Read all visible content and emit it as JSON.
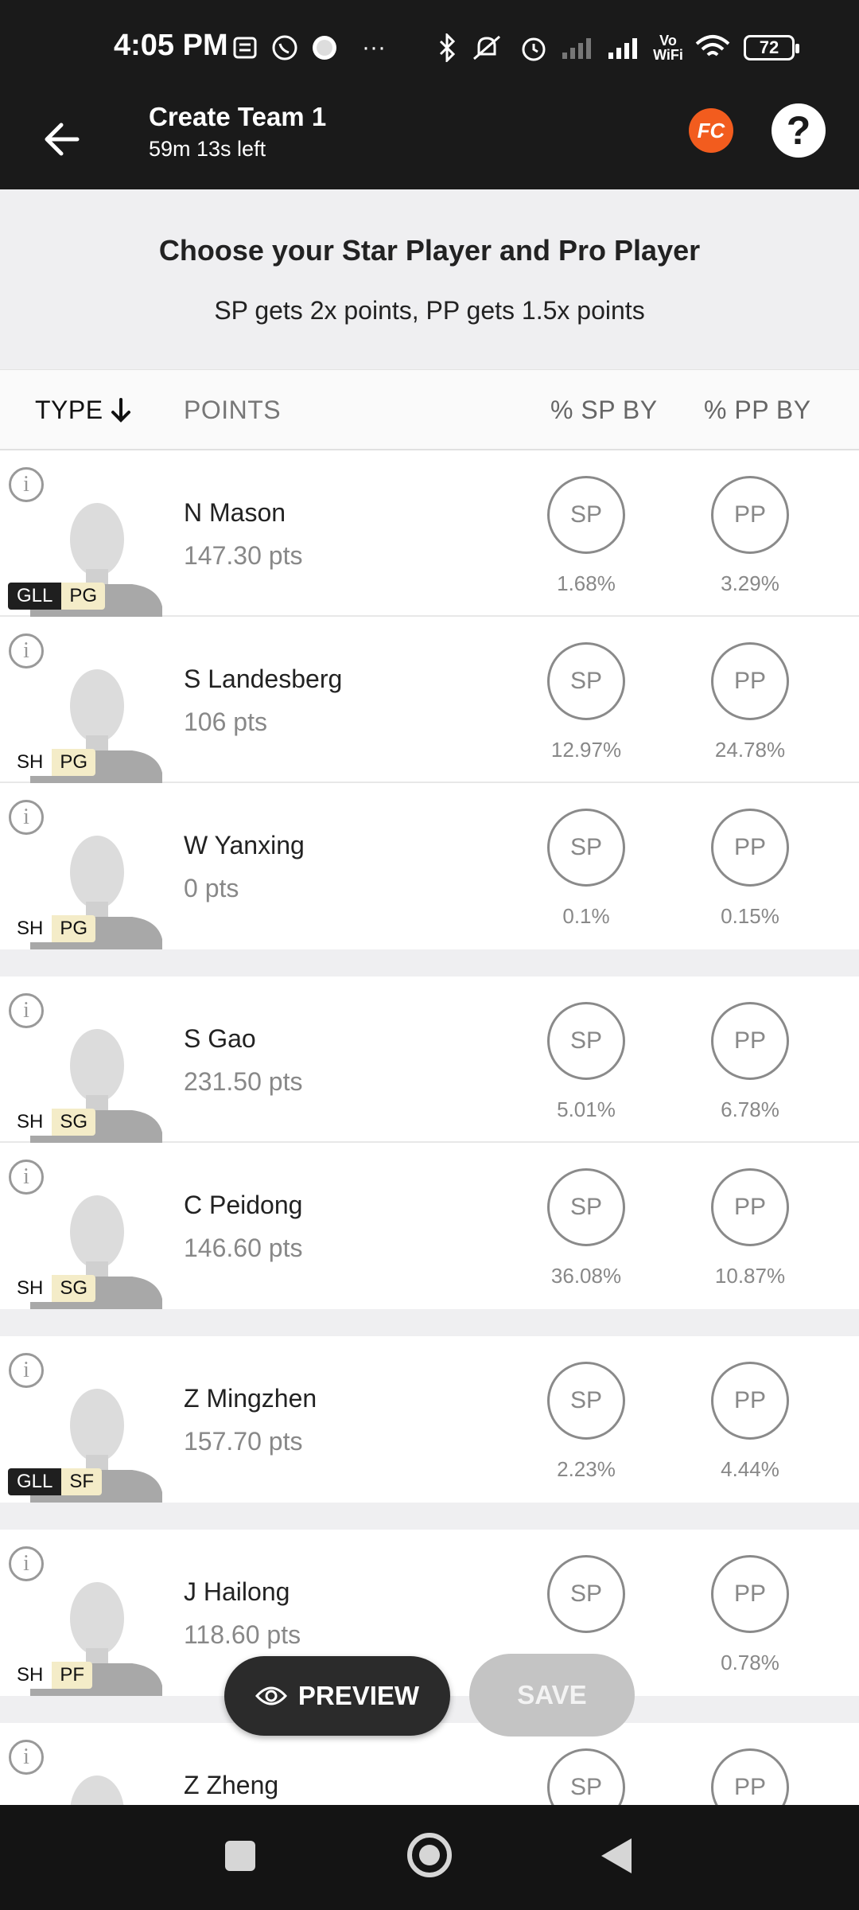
{
  "status_bar": {
    "time": "4:05 PM",
    "battery": "72",
    "icons": [
      "message-icon",
      "whatsapp-icon",
      "record-icon",
      "more-icon",
      "bluetooth-icon",
      "mute-icon",
      "alarm-icon",
      "signal-icon",
      "signal-icon",
      "vowifi-icon",
      "wifi-icon",
      "battery-icon"
    ]
  },
  "header": {
    "title": "Create Team 1",
    "subtitle": "59m 13s left",
    "logo_text": "FC",
    "help_label": "?"
  },
  "instructions": {
    "title": "Choose your Star Player and Pro Player",
    "subtitle": "SP gets 2x points, PP gets 1.5x points"
  },
  "table_header": {
    "type": "TYPE",
    "points": "POINTS",
    "sp_by": "% SP BY",
    "pp_by": "% PP BY"
  },
  "buttons": {
    "sp": "SP",
    "pp": "PP",
    "preview": "PREVIEW",
    "save": "SAVE"
  },
  "players": [
    {
      "name": "N Mason",
      "points": "147.30 pts",
      "team": "GLL",
      "position": "PG",
      "sp_pct": "1.68%",
      "pp_pct": "3.29%"
    },
    {
      "name": "S Landesberg",
      "points": "106 pts",
      "team": "SH",
      "position": "PG",
      "sp_pct": "12.97%",
      "pp_pct": "24.78%"
    },
    {
      "name": "W Yanxing",
      "points": "0 pts",
      "team": "SH",
      "position": "PG",
      "sp_pct": "0.1%",
      "pp_pct": "0.15%"
    },
    {
      "name": "S Gao",
      "points": "231.50 pts",
      "team": "SH",
      "position": "SG",
      "sp_pct": "5.01%",
      "pp_pct": "6.78%"
    },
    {
      "name": "C Peidong",
      "points": "146.60 pts",
      "team": "SH",
      "position": "SG",
      "sp_pct": "36.08%",
      "pp_pct": "10.87%"
    },
    {
      "name": "Z Mingzhen",
      "points": "157.70 pts",
      "team": "GLL",
      "position": "SF",
      "sp_pct": "2.23%",
      "pp_pct": "4.44%"
    },
    {
      "name": "J Hailong",
      "points": "118.60 pts",
      "team": "SH",
      "position": "PF",
      "sp_pct": "",
      "pp_pct": "0.78%"
    },
    {
      "name": "Z Zheng",
      "points": "",
      "team": "",
      "position": "",
      "sp_pct": "",
      "pp_pct": ""
    }
  ]
}
